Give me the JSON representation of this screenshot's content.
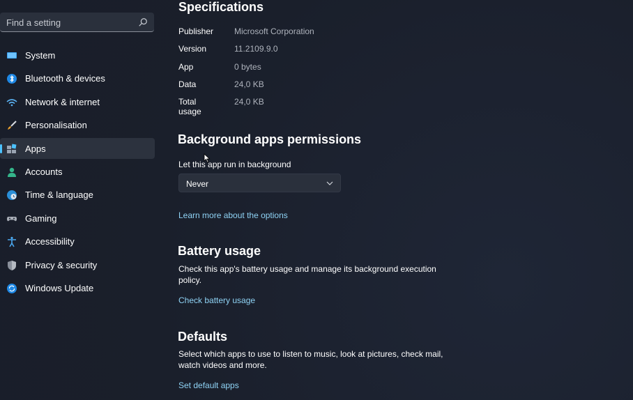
{
  "search": {
    "placeholder": "Find a setting"
  },
  "sidebar": {
    "items": [
      {
        "label": "System",
        "icon": "monitor-icon"
      },
      {
        "label": "Bluetooth & devices",
        "icon": "bluetooth-icon"
      },
      {
        "label": "Network & internet",
        "icon": "wifi-icon"
      },
      {
        "label": "Personalisation",
        "icon": "brush-icon"
      },
      {
        "label": "Apps",
        "icon": "apps-icon",
        "active": true
      },
      {
        "label": "Accounts",
        "icon": "person-icon"
      },
      {
        "label": "Time & language",
        "icon": "globe-clock-icon"
      },
      {
        "label": "Gaming",
        "icon": "gamepad-icon"
      },
      {
        "label": "Accessibility",
        "icon": "accessibility-icon"
      },
      {
        "label": "Privacy & security",
        "icon": "shield-icon"
      },
      {
        "label": "Windows Update",
        "icon": "update-icon"
      }
    ]
  },
  "specifications": {
    "title": "Specifications",
    "rows": [
      {
        "key": "Publisher",
        "value": "Microsoft Corporation"
      },
      {
        "key": "Version",
        "value": "11.2109.9.0"
      },
      {
        "key": "App",
        "value": "0 bytes"
      },
      {
        "key": "Data",
        "value": "24,0 KB"
      },
      {
        "key": "Total usage",
        "value": "24,0 KB"
      }
    ]
  },
  "background": {
    "title": "Background apps permissions",
    "label": "Let this app run in background",
    "selected": "Never",
    "link": "Learn more about the options"
  },
  "battery": {
    "title": "Battery usage",
    "desc": "Check this app's battery usage and manage its background execution policy.",
    "link": "Check battery usage"
  },
  "defaults": {
    "title": "Defaults",
    "desc": "Select which apps to use to listen to music, look at pictures, check mail, watch videos and more.",
    "link": "Set default apps"
  },
  "colors": {
    "accent": "#4cc2ff",
    "link": "#8fd3f5"
  }
}
